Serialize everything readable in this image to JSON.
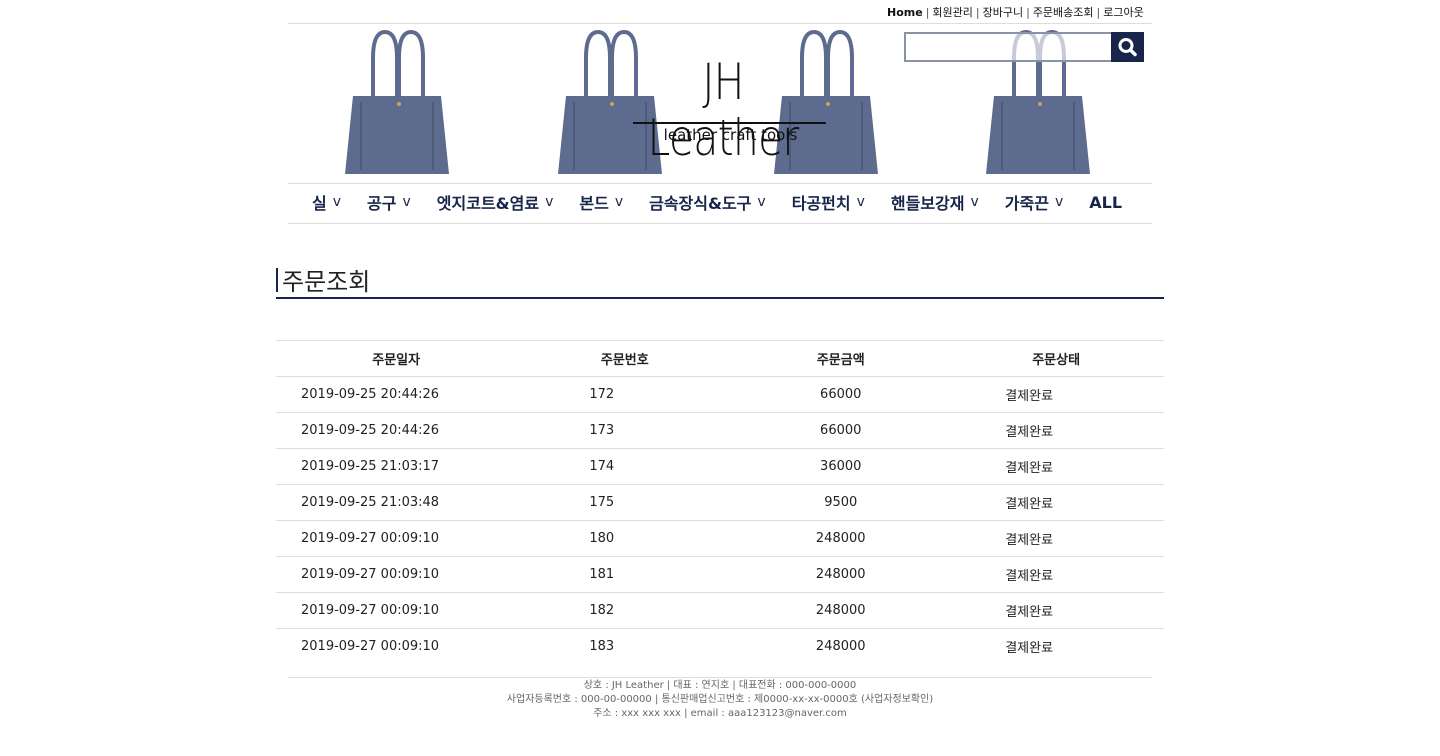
{
  "top_links": {
    "home": "Home",
    "members": "회원관리",
    "cart": "장바구니",
    "order_tracking": "주문배송조회",
    "logout": "로그아웃",
    "separator": "|"
  },
  "logo": {
    "title": "JH Leather",
    "subtitle": "leather craft tools"
  },
  "search": {
    "placeholder": "",
    "value": "",
    "icon": "search-icon"
  },
  "nav": {
    "items": [
      {
        "label": "실",
        "chevron": "v"
      },
      {
        "label": "공구",
        "chevron": "v"
      },
      {
        "label": "엣지코트&염료",
        "chevron": "v"
      },
      {
        "label": "본드",
        "chevron": "v"
      },
      {
        "label": "금속장식&도구",
        "chevron": "v"
      },
      {
        "label": "타공펀치",
        "chevron": "v"
      },
      {
        "label": "핸들보강재",
        "chevron": "v"
      },
      {
        "label": "가죽끈",
        "chevron": "v"
      }
    ],
    "all_label": "ALL"
  },
  "page": {
    "title": "주문조회"
  },
  "orders_table": {
    "headers": [
      "주문일자",
      "주문번호",
      "주문금액",
      "주문상태"
    ],
    "rows": [
      [
        "2019-09-25 20:44:26",
        "172",
        "66000",
        "결제완료"
      ],
      [
        "2019-09-25 20:44:26",
        "173",
        "66000",
        "결제완료"
      ],
      [
        "2019-09-25 21:03:17",
        "174",
        "36000",
        "결제완료"
      ],
      [
        "2019-09-25 21:03:48",
        "175",
        "9500",
        "결제완료"
      ],
      [
        "2019-09-27 00:09:10",
        "180",
        "248000",
        "결제완료"
      ],
      [
        "2019-09-27 00:09:10",
        "181",
        "248000",
        "결제완료"
      ],
      [
        "2019-09-27 00:09:10",
        "182",
        "248000",
        "결제완료"
      ],
      [
        "2019-09-27 00:09:10",
        "183",
        "248000",
        "결제완료"
      ]
    ]
  },
  "footer": {
    "line1": "상호 : JH Leather | 대표 : 연지호 | 대표전화 : 000-000-0000",
    "line2": "사업자등록번호 : 000-00-00000 | 통신판매업신고번호 : 제0000-xx-xx-0000호 (사업자정보확인)",
    "line3": "주소 : xxx xxx xxx | email : aaa123123@naver.com"
  },
  "colors": {
    "accent": "#17254a",
    "bag": "#5c6b8e",
    "divider": "#dddddd"
  }
}
